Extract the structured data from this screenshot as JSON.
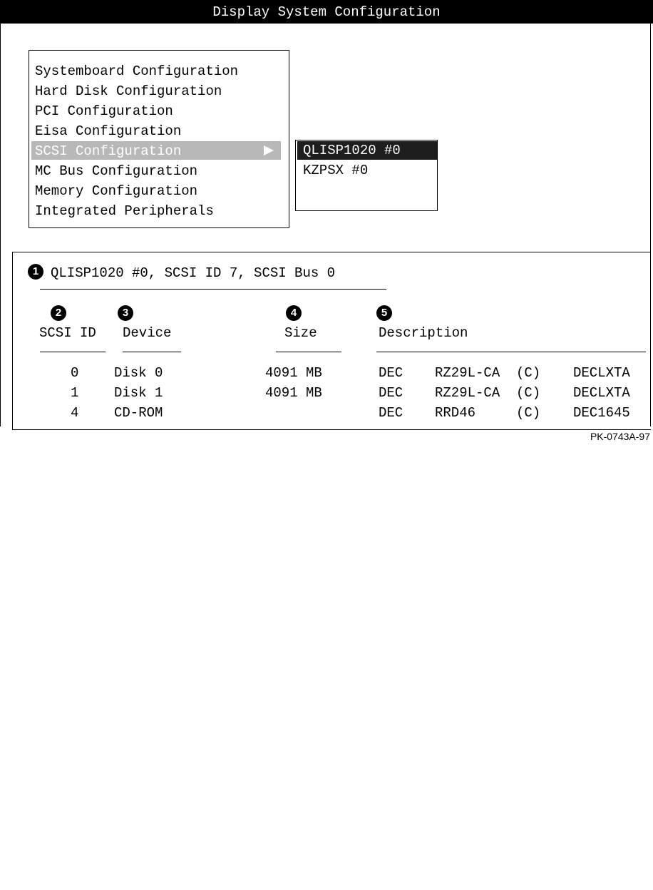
{
  "window": {
    "title": "Display System Configuration"
  },
  "menu": {
    "items": [
      "Systemboard Configuration",
      "Hard Disk Configuration",
      "PCI Configuration",
      "Eisa Configuration",
      "SCSI Configuration",
      "MC Bus Configuration",
      "Memory Configuration",
      "Integrated Peripherals"
    ],
    "selected": "SCSI Configuration"
  },
  "submenu": {
    "items": [
      "QLISP1020 #0",
      "KZPSX #0"
    ],
    "selected": "QLISP1020 #0"
  },
  "details": {
    "summary": "QLISP1020 #0, SCSI ID 7, SCSI Bus 0",
    "callouts": [
      "1",
      "2",
      "3",
      "4",
      "5"
    ],
    "columns": {
      "scsi_id": "SCSI ID",
      "device": "Device",
      "size": "Size",
      "description": "Description"
    },
    "rows": [
      {
        "scsi_id": "0",
        "device": "Disk 0",
        "size": "4091 MB",
        "vendor": "DEC",
        "model": "RZ29L-CA",
        "flag": "(C)",
        "firmware": "DECLXTA"
      },
      {
        "scsi_id": "1",
        "device": "Disk 1",
        "size": "4091 MB",
        "vendor": "DEC",
        "model": "RZ29L-CA",
        "flag": "(C)",
        "firmware": "DECLXTA"
      },
      {
        "scsi_id": "4",
        "device": "CD-ROM",
        "size": "",
        "vendor": "DEC",
        "model": "RRD46",
        "flag": "(C)",
        "firmware": "DEC1645"
      }
    ]
  },
  "figure_id": "PK-0743A-97"
}
